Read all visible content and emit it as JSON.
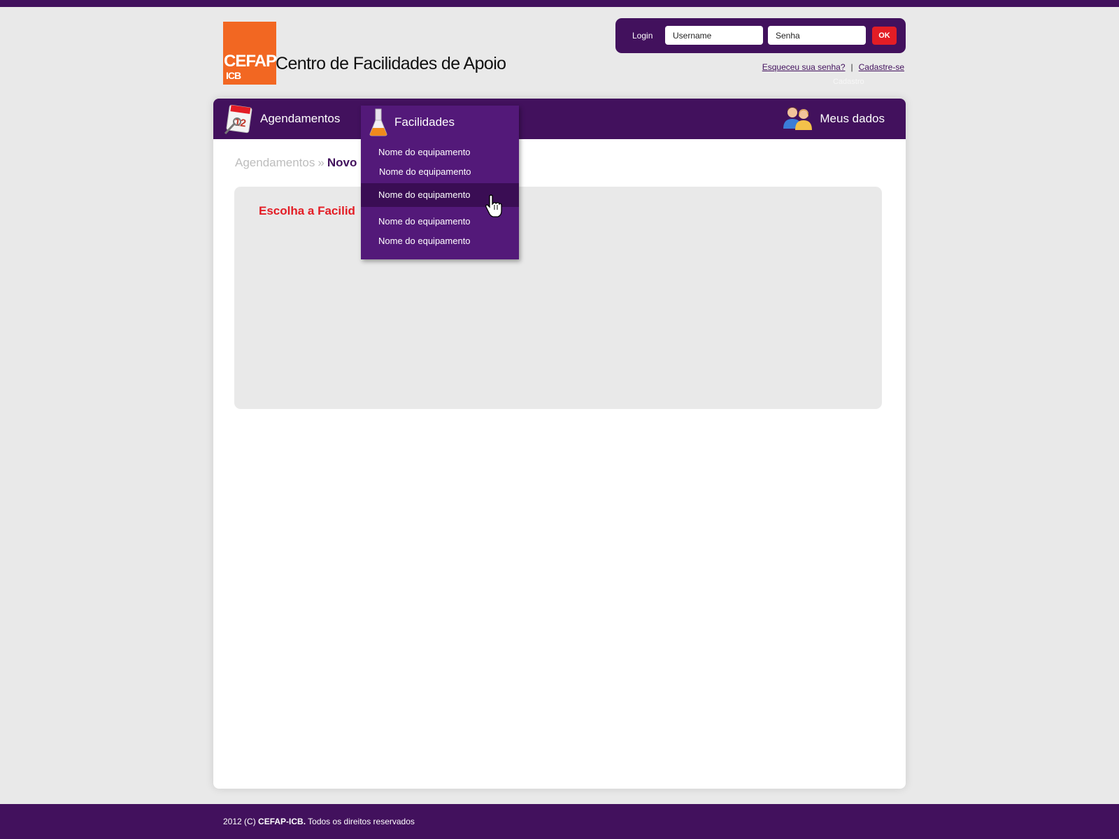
{
  "header": {
    "logo_main": "CEFAP",
    "logo_sub": "ICB",
    "site_title": "Centro de Facilidades de Apoio"
  },
  "login": {
    "label": "Login",
    "username_value": "Username",
    "password_value": "Senha",
    "ok_label": "OK",
    "forgot_link": "Esqueceu sua senha?",
    "separator": "|",
    "register_link": "Cadastre-se",
    "faint_label": "Cadastro"
  },
  "nav": {
    "agendamentos": {
      "label": "Agendamentos",
      "icon": "calendar-icon"
    },
    "facilidades": {
      "label": "Facilidades",
      "icon": "flask-icon"
    },
    "meus_dados": {
      "label": "Meus dados",
      "icon": "users-icon"
    }
  },
  "dropdown": {
    "items": [
      "Nome do equipamento",
      "Nome do equipamento",
      "Nome do equipamento",
      "Nome do equipamento",
      "Nome do equipamento"
    ],
    "hovered_index": 2
  },
  "breadcrumb": {
    "parent": "Agendamentos",
    "separator": "»",
    "current": "Novo"
  },
  "content": {
    "heading": "Escolha a Facilid"
  },
  "footer": {
    "prefix": "2012 (C) ",
    "brand": "CEFAP-ICB.",
    "suffix": " Todos os direitos reservados"
  },
  "colors": {
    "purple": "#42115d",
    "dropdown_purple": "#531979",
    "dropdown_hover": "#3a0d54",
    "accent_red": "#e31d25",
    "logo_orange": "#f26722",
    "background": "#e9e9e9"
  }
}
